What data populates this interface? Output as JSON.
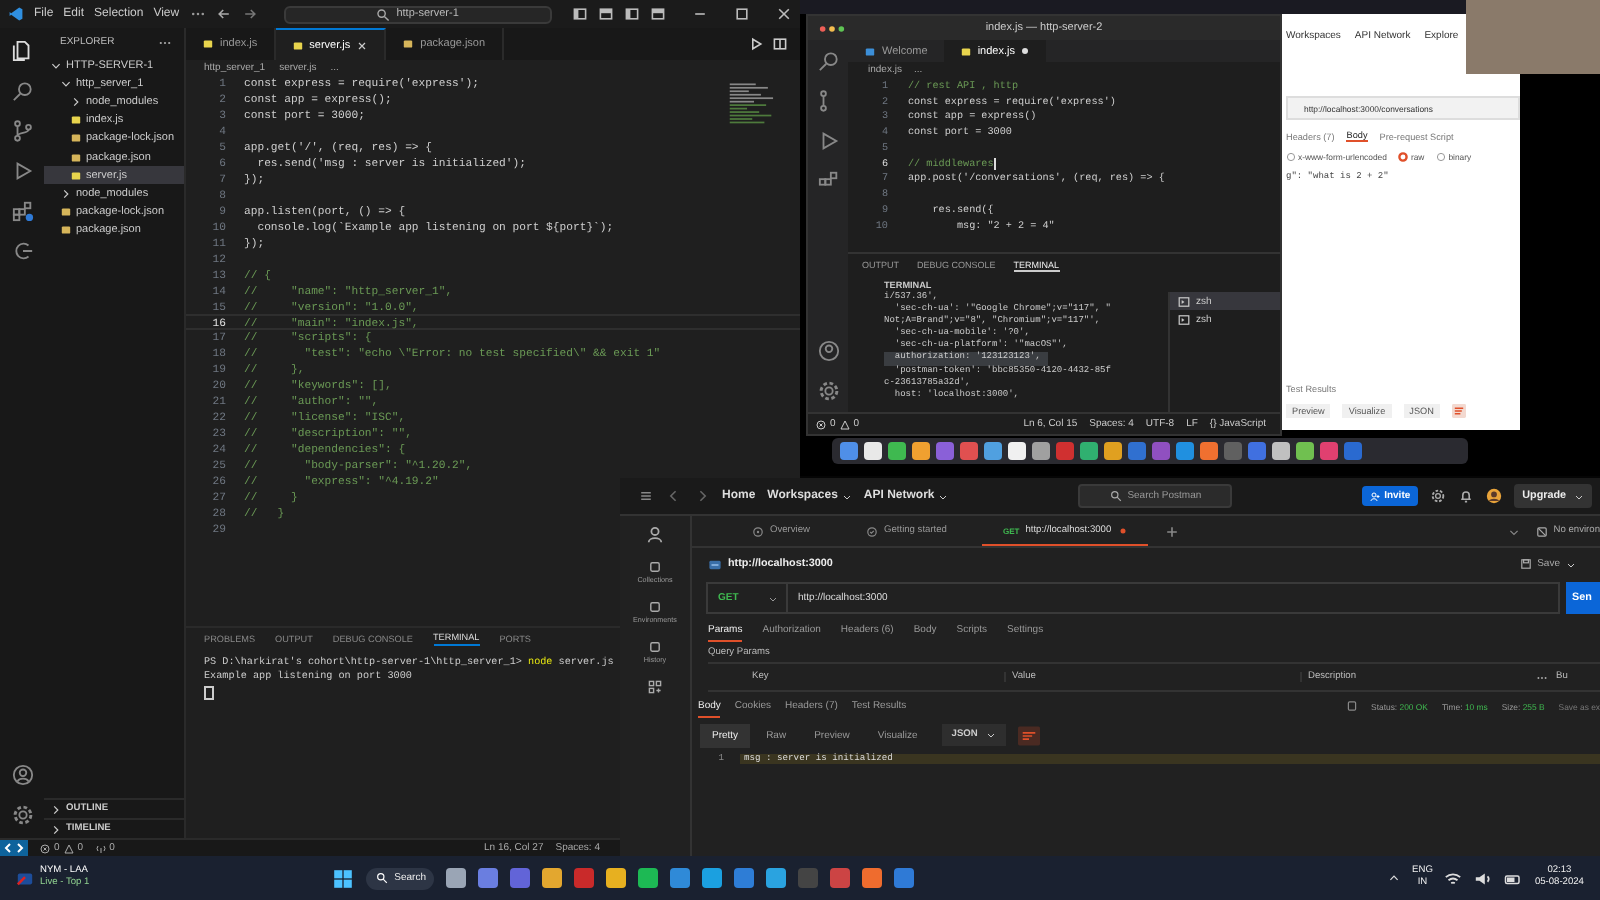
{
  "left_editor": {
    "menu": [
      "File",
      "Edit",
      "Selection",
      "View"
    ],
    "command_center": "http-server-1",
    "explorer_title": "EXPLORER",
    "tree": [
      {
        "label": "HTTP-SERVER-1",
        "kind": "folder",
        "expanded": true,
        "selected": false,
        "children": [
          {
            "label": "http_server_1",
            "kind": "folder",
            "expanded": true,
            "selected": false,
            "children": [
              {
                "label": "node_modules",
                "kind": "folder",
                "expanded": false,
                "selected": false
              },
              {
                "label": "index.js",
                "kind": "js",
                "selected": false
              },
              {
                "label": "package-lock.json",
                "kind": "json",
                "selected": false
              },
              {
                "label": "package.json",
                "kind": "json",
                "selected": false
              },
              {
                "label": "server.js",
                "kind": "js",
                "selected": true
              }
            ]
          },
          {
            "label": "node_modules",
            "kind": "folder",
            "expanded": false,
            "selected": false
          },
          {
            "label": "package-lock.json",
            "kind": "json",
            "selected": false
          },
          {
            "label": "package.json",
            "kind": "json",
            "selected": false
          }
        ]
      }
    ],
    "tabs": [
      {
        "label": "index.js",
        "kind": "js",
        "selected": false
      },
      {
        "label": "server.js",
        "kind": "js",
        "selected": true
      },
      {
        "label": "package.json",
        "kind": "json",
        "selected": false
      }
    ],
    "breadcrumb": [
      "http_server_1",
      "server.js",
      "..."
    ],
    "lines": [
      {
        "n": "1",
        "kind": "code",
        "code": "const express = require('express');",
        "current": false
      },
      {
        "n": "2",
        "kind": "code",
        "code": "const app = express();",
        "current": false
      },
      {
        "n": "3",
        "kind": "code",
        "code": "const port = 3000;",
        "current": false
      },
      {
        "n": "4",
        "kind": "blank",
        "current": false
      },
      {
        "n": "5",
        "kind": "code",
        "code": "app.get('/', (req, res) => {",
        "current": false
      },
      {
        "n": "6",
        "kind": "code",
        "code": "  res.send('msg : server is initialized');",
        "current": false
      },
      {
        "n": "7",
        "kind": "code",
        "code": "});",
        "current": false
      },
      {
        "n": "8",
        "kind": "blank",
        "current": false
      },
      {
        "n": "9",
        "kind": "code",
        "code": "app.listen(port, () => {",
        "current": false
      },
      {
        "n": "10",
        "kind": "code",
        "code": "  console.log(`Example app listening on port ${port}`);",
        "current": false
      },
      {
        "n": "11",
        "kind": "code",
        "code": "});",
        "current": false
      },
      {
        "n": "12",
        "kind": "blank",
        "current": false
      },
      {
        "n": "13",
        "kind": "comment",
        "code": "// {",
        "current": false
      },
      {
        "n": "14",
        "kind": "comment",
        "code": "//     \"name\": \"http_server_1\",",
        "current": false
      },
      {
        "n": "15",
        "kind": "comment",
        "code": "//     \"version\": \"1.0.0\",",
        "current": false
      },
      {
        "n": "16",
        "kind": "comment",
        "code": "//     \"main\": \"index.js\",",
        "current": true
      },
      {
        "n": "17",
        "kind": "comment",
        "code": "//     \"scripts\": {",
        "current": false
      },
      {
        "n": "18",
        "kind": "comment",
        "code": "//       \"test\": \"echo \\\"Error: no test specified\\\" && exit 1\"",
        "current": false
      },
      {
        "n": "19",
        "kind": "comment",
        "code": "//     },",
        "current": false
      },
      {
        "n": "20",
        "kind": "comment",
        "code": "//     \"keywords\": [],",
        "current": false
      },
      {
        "n": "21",
        "kind": "comment",
        "code": "//     \"author\": \"\",",
        "current": false
      },
      {
        "n": "22",
        "kind": "comment",
        "code": "//     \"license\": \"ISC\",",
        "current": false
      },
      {
        "n": "23",
        "kind": "comment",
        "code": "//     \"description\": \"\",",
        "current": false
      },
      {
        "n": "24",
        "kind": "comment",
        "code": "//     \"dependencies\": {",
        "current": false
      },
      {
        "n": "25",
        "kind": "comment",
        "code": "//       \"body-parser\": \"^1.20.2\",",
        "current": false
      },
      {
        "n": "26",
        "kind": "comment",
        "code": "//       \"express\": \"^4.19.2\"",
        "current": false
      },
      {
        "n": "27",
        "kind": "comment",
        "code": "//     }",
        "current": false
      },
      {
        "n": "28",
        "kind": "comment",
        "code": "//   }",
        "current": false
      },
      {
        "n": "29",
        "kind": "blank",
        "current": false
      }
    ],
    "panel_tabs": [
      {
        "label": "PROBLEMS",
        "selected": false
      },
      {
        "label": "OUTPUT",
        "selected": false
      },
      {
        "label": "DEBUG CONSOLE",
        "selected": false
      },
      {
        "label": "TERMINAL",
        "selected": true
      },
      {
        "label": "PORTS",
        "selected": false
      }
    ],
    "terminal": [
      {
        "kind": "command",
        "prompt": "PS D:\\harkirat's cohort\\http-server-1\\http_server_1>",
        "command": "node",
        "args": "server.js"
      },
      {
        "kind": "output",
        "text": "Example app listening on port 3000"
      }
    ],
    "sections": [
      "OUTLINE",
      "TIMELINE"
    ],
    "status_bar": {
      "errors": "0",
      "warnings": "0",
      "ports": "0",
      "position": "Ln 16, Col 27",
      "spaces": "Spaces: 4"
    }
  },
  "mac_editor": {
    "title": "index.js — http-server-2",
    "tabs": [
      {
        "label": "Welcome",
        "kind": "welcome",
        "selected": false,
        "modified": false
      },
      {
        "label": "index.js",
        "kind": "js",
        "selected": true,
        "modified": true
      }
    ],
    "breadcrumb": [
      "index.js",
      "..."
    ],
    "lines": [
      {
        "n": "1",
        "kind": "comment",
        "code": "// rest API , http",
        "current": false
      },
      {
        "n": "2",
        "kind": "code",
        "code": "const express = require('express')",
        "current": false
      },
      {
        "n": "3",
        "kind": "code",
        "code": "const app = express()",
        "current": false
      },
      {
        "n": "4",
        "kind": "code",
        "code": "const port = 3000",
        "current": false
      },
      {
        "n": "5",
        "kind": "blank",
        "current": false
      },
      {
        "n": "6",
        "kind": "comment",
        "code": "// middlewares",
        "current": true
      },
      {
        "n": "7",
        "kind": "code",
        "code": "app.post('/conversations', (req, res) => {",
        "current": false
      },
      {
        "n": "8",
        "kind": "blank",
        "current": false
      },
      {
        "n": "9",
        "kind": "code",
        "code": "    res.send({",
        "current": false
      },
      {
        "n": "10",
        "kind": "code",
        "code": "        msg: \"2 + 2 = 4\"",
        "current": false
      }
    ],
    "panel_tabs": [
      {
        "label": "OUTPUT",
        "selected": false
      },
      {
        "label": "DEBUG CONSOLE",
        "selected": false
      },
      {
        "label": "TERMINAL",
        "selected": true
      }
    ],
    "section": "TERMINAL",
    "terminal": [
      {
        "text": "i/537.36',",
        "selected": false
      },
      {
        "text": "  'sec-ch-ua': '\"Google Chrome\";v=\"117\", \"",
        "selected": false
      },
      {
        "text": "Not;A=Brand\";v=\"8\", \"Chromium\";v=\"117\"',",
        "selected": false
      },
      {
        "text": "  'sec-ch-ua-mobile': '?0',",
        "selected": false
      },
      {
        "text": "  'sec-ch-ua-platform': '\"macOS\"',",
        "selected": false
      },
      {
        "text": "  authorization: '123123123',",
        "selected": true
      },
      {
        "text": "  'postman-token': 'bbc85350-4120-4432-85f",
        "selected": false
      },
      {
        "text": "c-23613785a32d',",
        "selected": false
      },
      {
        "text": "  host: 'localhost:3000',",
        "selected": false
      }
    ],
    "shells": [
      {
        "label": "zsh",
        "selected": true
      },
      {
        "label": "zsh",
        "selected": false
      }
    ],
    "status_bar": {
      "errors": "0",
      "warnings": "0",
      "items": [
        "Ln 6, Col 15",
        "Spaces: 4",
        "UTF-8",
        "LF",
        "{} JavaScript"
      ]
    }
  },
  "browser_postman": {
    "nav": [
      "Workspaces",
      "API Network",
      "Explore"
    ],
    "url": "http://localhost:3000/conversations",
    "tabs": [
      {
        "label": "Headers (7)",
        "selected": false
      },
      {
        "label": "Body",
        "selected": true
      },
      {
        "label": "Pre-request Script",
        "selected": false
      }
    ],
    "body_types": [
      {
        "label": "x-www-form-urlencoded",
        "selected": false
      },
      {
        "label": "raw",
        "selected": true
      },
      {
        "label": "binary",
        "selected": false
      }
    ],
    "body_line": "g\": \"what is 2 + 2\"",
    "response_tabs": [
      "Test Results"
    ],
    "buttons": [
      "Preview",
      "Visualize"
    ],
    "format": "JSON"
  },
  "postman": {
    "nav": [
      {
        "label": "Home",
        "kind": "link"
      },
      {
        "label": "Workspaces",
        "kind": "menu"
      },
      {
        "label": "API Network",
        "kind": "menu"
      }
    ],
    "search": {
      "placeholder": "Search Postman"
    },
    "invite": "Invite",
    "upgrade": "Upgrade",
    "sidebar": [
      "Collections",
      "Environments",
      "History"
    ],
    "tabs": [
      {
        "label": "Overview",
        "kind": "overview",
        "selected": false
      },
      {
        "label": "Getting started",
        "kind": "guide",
        "selected": false
      },
      {
        "method": "GET",
        "label": "http://localhost:3000",
        "kind": "request",
        "selected": true,
        "unsaved": true
      }
    ],
    "environment": "No environ",
    "request_name": "http://localhost:3000",
    "save": "Save",
    "method": "GET",
    "url": "http://localhost:3000",
    "send": "Sen",
    "request_tabs": [
      {
        "label": "Params",
        "selected": true
      },
      {
        "label": "Authorization",
        "selected": false
      },
      {
        "label": "Headers (6)",
        "selected": false
      },
      {
        "label": "Body",
        "selected": false
      },
      {
        "label": "Scripts",
        "selected": false
      },
      {
        "label": "Settings",
        "selected": false
      }
    ],
    "query_params_title": "Query Params",
    "param_columns": [
      "Key",
      "Value",
      "Description"
    ],
    "bulk_edit": "Bu",
    "response_tabs": [
      {
        "label": "Body",
        "selected": true
      },
      {
        "label": "Cookies",
        "selected": false
      },
      {
        "label": "Headers (7)",
        "selected": false
      },
      {
        "label": "Test Results",
        "selected": false
      }
    ],
    "status": [
      {
        "label": "Status:",
        "value": "200 OK"
      },
      {
        "label": "Time:",
        "value": "10 ms"
      },
      {
        "label": "Size:",
        "value": "255 B"
      }
    ],
    "save_response": "Save as ex",
    "format_tabs": [
      {
        "label": "Pretty",
        "selected": true
      },
      {
        "label": "Raw",
        "selected": false
      },
      {
        "label": "Preview",
        "selected": false
      },
      {
        "label": "Visualize",
        "selected": false
      }
    ],
    "format": "JSON",
    "response_lines": [
      {
        "n": "1",
        "text": "msg : server is initialized"
      }
    ]
  },
  "taskbar": {
    "widget_title": "NYM - LAA",
    "widget_subtitle": "Live - Top 1",
    "search": "Search",
    "language": "ENG",
    "region": "IN",
    "time": "02:13",
    "date": "05-08-2024"
  }
}
